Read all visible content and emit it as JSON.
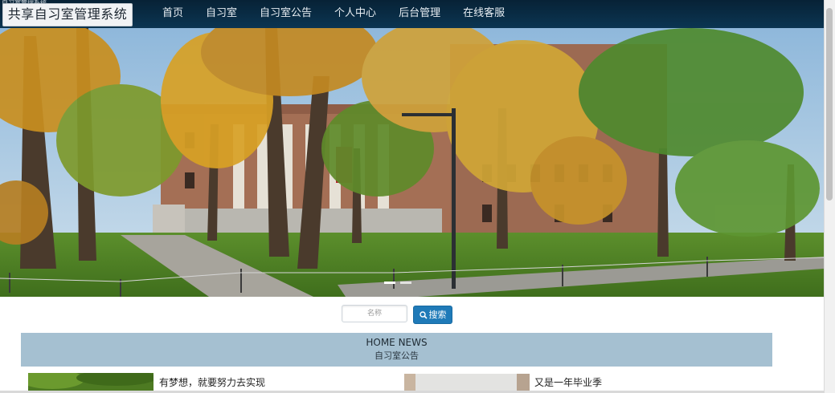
{
  "window": {
    "caption": "自习室管理系统"
  },
  "brand": {
    "title": "共享自习室管理系统"
  },
  "nav": {
    "items": [
      "首页",
      "自习室",
      "自习室公告",
      "个人中心",
      "后台管理",
      "在线客服"
    ]
  },
  "search": {
    "placeholder": "名称",
    "button_label": "搜索"
  },
  "news": {
    "title_en": "HOME NEWS",
    "title_cn": "自习室公告",
    "items": [
      {
        "title": "有梦想，就要努力去实现"
      },
      {
        "title": "又是一年毕业季"
      }
    ]
  },
  "colors": {
    "nav_background": "#072236",
    "search_button": "#1f7ab8",
    "news_bar": "#a5c0d1"
  }
}
